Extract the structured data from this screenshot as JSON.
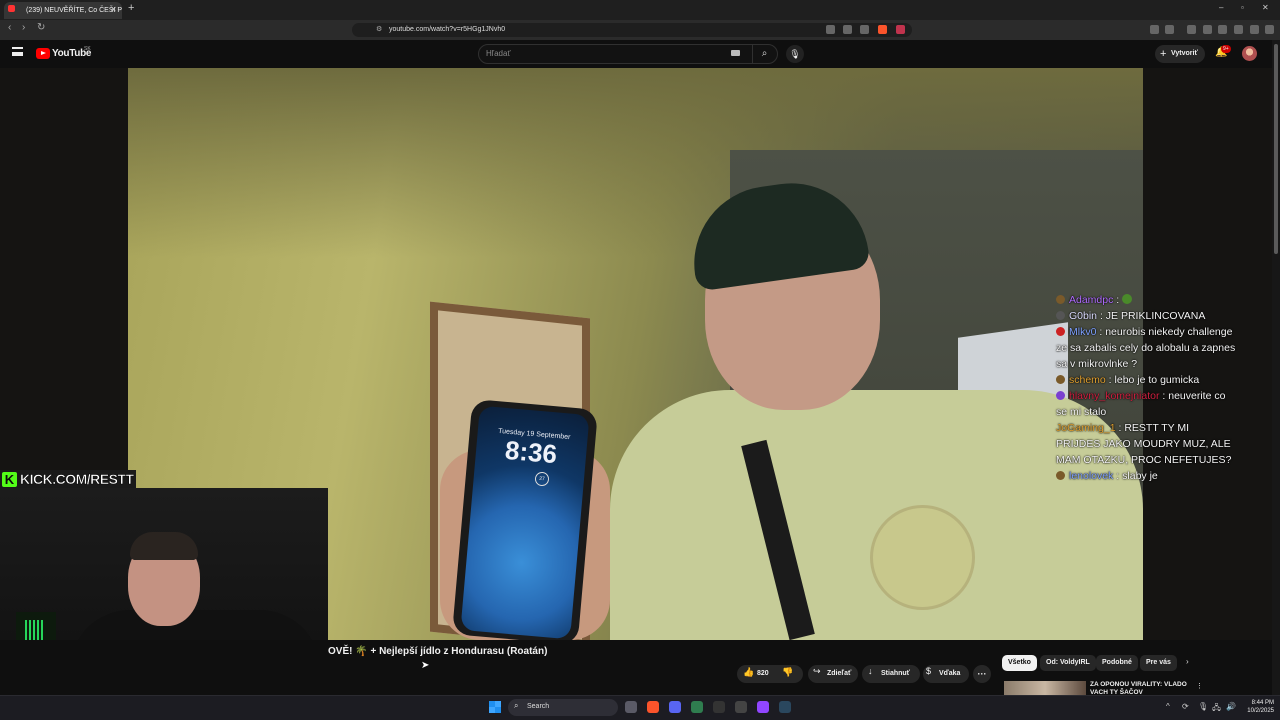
{
  "browser": {
    "tab_title": "(239) NEUVĚŘÍTE, Co ČEŠI Pr",
    "tab_close": "✕",
    "new_tab": "+",
    "url": "youtube.com/watch?v=r5HGg1JNvh0",
    "window_controls": [
      "–",
      "▫",
      "✕"
    ]
  },
  "youtube": {
    "logo_text": "YouTube",
    "region": "SK",
    "search_placeholder": "Hľadať",
    "create_label": "Vytvoriť",
    "notifications_badge": "9+"
  },
  "video": {
    "phone_date": "Tuesday 19 September",
    "phone_time": "8:36",
    "phone_weather": "27",
    "kick_text": "KICK.COM/RESTT",
    "kick_letter": "K"
  },
  "chat": [
    {
      "user": "Adamdpc",
      "msg": "",
      "color": "#b06dff",
      "badge": "#7a5a2a"
    },
    {
      "user": "G0bin",
      "msg": "JE PRIKLINCOVANA",
      "color": "#dcdcff",
      "badge": "#555"
    },
    {
      "user": "Mlkv0",
      "msg": "neurobis niekedy challenge ze sa zabalis cely do alobalu a zapnes sa v mikrovlnke ?",
      "color": "#7fa2ff",
      "badge": "#cc2222"
    },
    {
      "user": "schemo",
      "msg": "lebo je to gumicka",
      "color": "#e0a030",
      "badge": "#7a5a2a"
    },
    {
      "user": "hlavny_komejniator",
      "msg": "neuverite co se mi stalo",
      "color": "#d02040",
      "badge": "#7a3fd0"
    },
    {
      "user": "JoGaming_1",
      "msg": "RESTT TY MI PRIJDES JAKO MOUDRY MUZ, ALE MAM OTAZKU, PROC NEFETUJES?",
      "color": "#e0a030",
      "badge": ""
    },
    {
      "user": "lenolovek",
      "msg": "slaby je",
      "color": "#7fa2ff",
      "badge": "#7a5a2a"
    }
  ],
  "below": {
    "title": "OVĚ! 🌴 + Nejlepší jídlo z Hondurasu (Roatán)",
    "like_count": "820",
    "share": "Zdieľať",
    "download": "Stiahnuť",
    "thanks": "Vďaka",
    "more": "···",
    "chips": [
      "Všetko",
      "Od: VoldyIRL",
      "Podobné",
      "Pre vás"
    ],
    "rec_title": "ZA OPONOU VIRALITY: VLADO VACH TY ŠAČOV"
  },
  "taskbar": {
    "search_label": "Search",
    "time": "8:44 PM",
    "date": "10/2/2025"
  }
}
